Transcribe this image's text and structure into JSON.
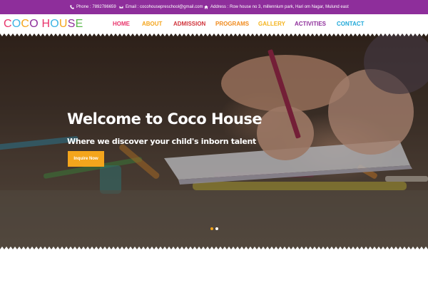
{
  "topbar": {
    "phone": "Phone : 7892786659",
    "email": "Email : cocohousepreschool@gmail.com",
    "address": "Address : Row house no 3, millennium park, Hari om Nagar, Mulund east"
  },
  "logo": {
    "text": "COCO HOUSE",
    "colors": [
      "#e8336b",
      "#3db3e3",
      "#f4a51c",
      "#8e2e9b",
      "#59b84b",
      "#e8336b",
      "#3db3e3",
      "#f4a51c",
      "#8e2e9b",
      "#59b84b"
    ]
  },
  "nav": [
    {
      "label": "HOME",
      "color": "#e8336b"
    },
    {
      "label": "ABOUT",
      "color": "#f4a51c"
    },
    {
      "label": "ADMISSION",
      "color": "#d0343c"
    },
    {
      "label": "PROGRAMS",
      "color": "#f08a1c"
    },
    {
      "label": "GALLERY",
      "color": "#f4b31c"
    },
    {
      "label": "ACTIVITIES",
      "color": "#8e2e9b"
    },
    {
      "label": "CONTACT",
      "color": "#1fa8d8"
    }
  ],
  "hero": {
    "title": "Welcome to Coco House",
    "subtitle": "Where we discover your child's inborn talent",
    "button": "Inquire Now"
  },
  "slider": {
    "active_index": 0,
    "count": 2,
    "active_color": "#f4a51c",
    "inactive_color": "#ffffff"
  },
  "colors": {
    "topbar": "#8e2e9b",
    "button": "#f4a51c"
  }
}
